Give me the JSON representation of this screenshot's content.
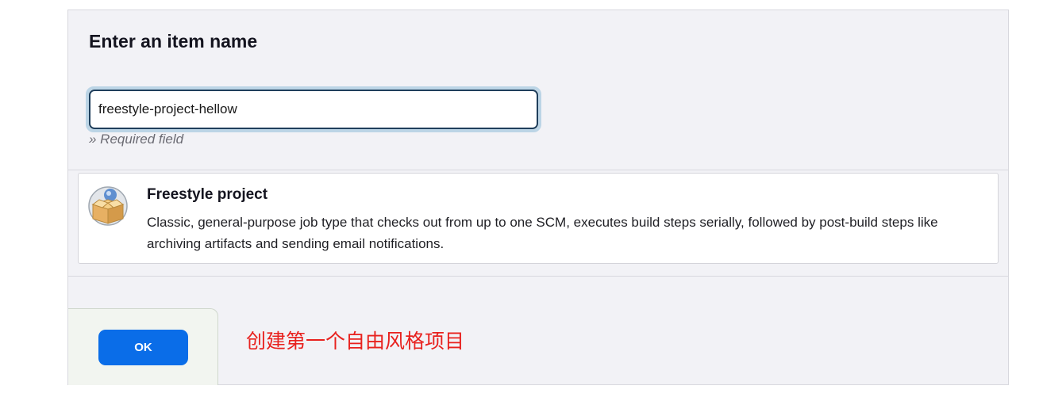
{
  "heading": "Enter an item name",
  "item_name_input": {
    "value": "freestyle-project-hellow"
  },
  "required_hint": "» Required field",
  "item_types": [
    {
      "icon": "freestyle-project-icon",
      "title": "Freestyle project",
      "description": "Classic, general-purpose job type that checks out from up to one SCM, executes build steps serially, followed by post-build steps like archiving artifacts and sending email notifications."
    }
  ],
  "ok_button": {
    "label": "OK"
  },
  "annotation": "创建第一个自由风格项目",
  "colors": {
    "accent": "#0a6de8",
    "annotation": "#e8211e",
    "panel_background": "#f2f2f6",
    "input_focus_ring": "#bcd5e6"
  }
}
